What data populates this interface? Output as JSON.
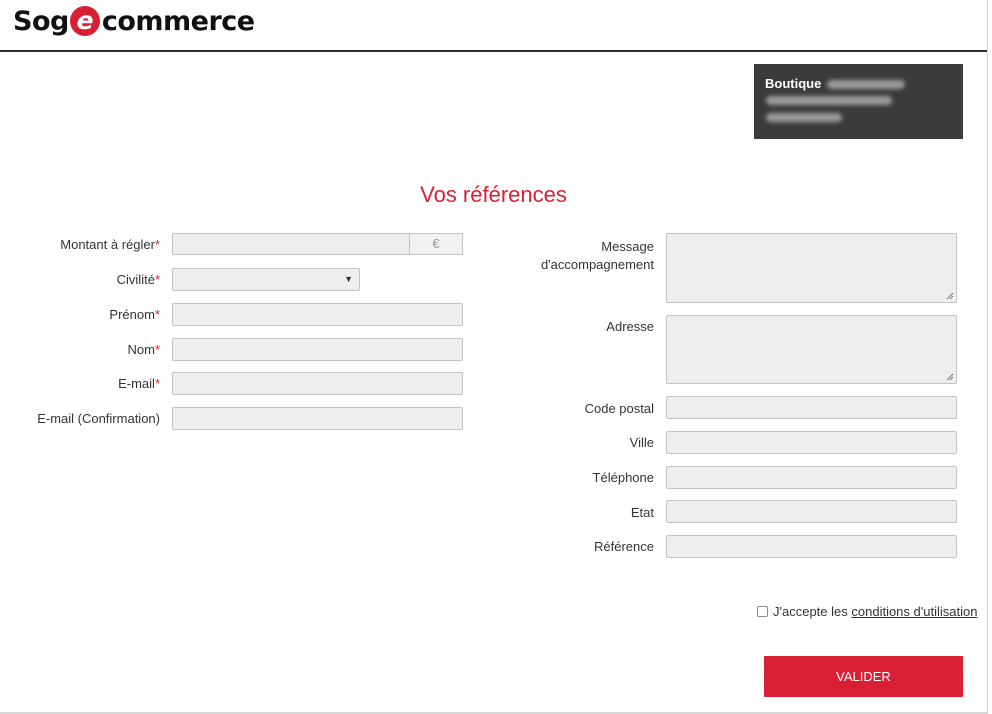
{
  "header": {
    "logo_left": "Sog",
    "logo_e": "e",
    "logo_right": "commerce"
  },
  "shop": {
    "label": "Boutique"
  },
  "title": "Vos références",
  "left_form": {
    "amount_label": "Montant à régler",
    "amount_currency": "€",
    "civility_label": "Civilité",
    "firstname_label": "Prénom",
    "lastname_label": "Nom",
    "email_label": "E-mail",
    "email_confirm_label": "E-mail (Confirmation)",
    "required_mark": "*"
  },
  "right_form": {
    "message_label_1": "Message",
    "message_label_2": "d'accompagnement",
    "address_label": "Adresse",
    "postal_label": "Code postal",
    "city_label": "Ville",
    "phone_label": "Téléphone",
    "state_label": "Etat",
    "reference_label": "Référence"
  },
  "terms": {
    "text": "J'accepte les",
    "link": "conditions d'utilisation",
    "checked": false
  },
  "submit_label": "VALIDER",
  "colors": {
    "accent": "#d81f34",
    "dark_box": "#3b3b3b",
    "field_bg": "#eeeeee"
  }
}
